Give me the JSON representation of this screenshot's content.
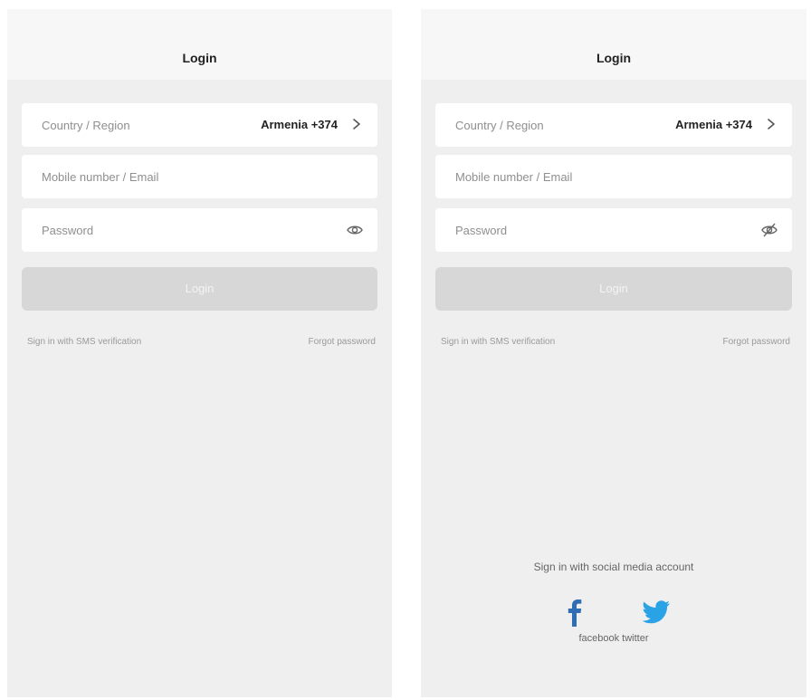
{
  "screens": [
    {
      "header": {
        "title": "Login"
      },
      "country": {
        "label": "Country / Region",
        "value": "Armenia +374"
      },
      "mobile": {
        "placeholder": "Mobile number / Email"
      },
      "password": {
        "placeholder": "Password"
      },
      "login_button": {
        "label": "Login"
      },
      "links": {
        "sms": "Sign in with SMS verification",
        "forgot": "Forgot password"
      }
    },
    {
      "header": {
        "title": "Login"
      },
      "country": {
        "label": "Country / Region",
        "value": "Armenia +374"
      },
      "mobile": {
        "placeholder": "Mobile number / Email"
      },
      "password": {
        "placeholder": "Password"
      },
      "login_button": {
        "label": "Login"
      },
      "links": {
        "sms": "Sign in with SMS verification",
        "forgot": "Forgot password"
      },
      "social": {
        "title": "Sign in with social media account",
        "caption": "facebook twitter",
        "icons": [
          "facebook-icon",
          "twitter-icon"
        ]
      }
    }
  ],
  "colors": {
    "facebook": "#2f6db4",
    "twitter": "#2aa2e6",
    "background": "#efefef"
  }
}
